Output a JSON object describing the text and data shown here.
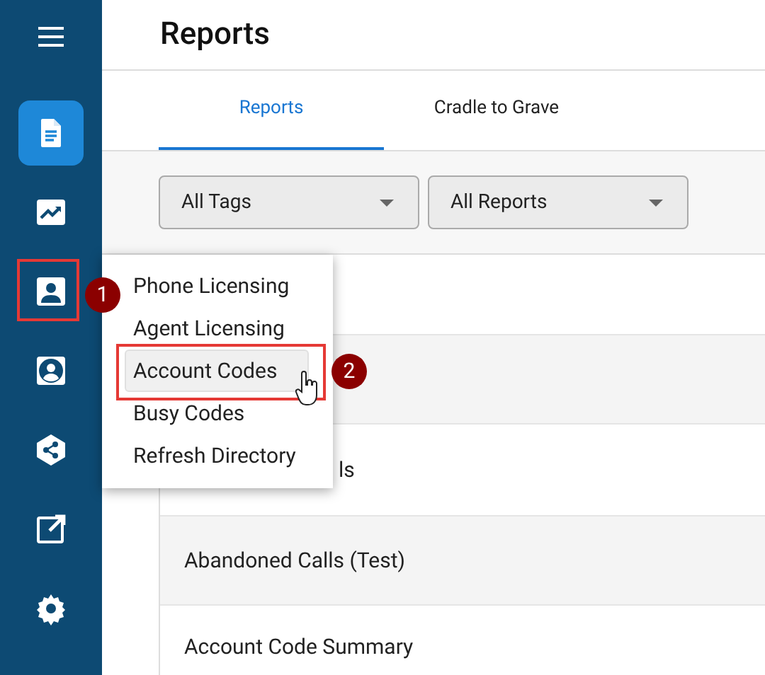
{
  "sidebar": {
    "items": [
      {
        "selected": true
      },
      {
        "selected": false
      },
      {
        "selected": false
      },
      {
        "selected": false
      },
      {
        "selected": false
      },
      {
        "selected": false
      },
      {
        "selected": false
      }
    ]
  },
  "title": "Reports",
  "tabs": [
    {
      "label": "Reports",
      "selected": true
    },
    {
      "label": "Cradle to Grave",
      "selected": false
    }
  ],
  "filters": [
    {
      "value": "All Tags"
    },
    {
      "value": "All Reports"
    }
  ],
  "rows": [
    {
      "kind": "blank"
    },
    {
      "kind": "blank"
    },
    {
      "text": "ls",
      "kind": "covered"
    },
    {
      "text": "Abandoned Calls (Test)",
      "kind": "plain"
    },
    {
      "text": "Account Code Summary",
      "kind": "plain"
    }
  ],
  "menu": {
    "items": [
      {
        "label": "Phone Licensing",
        "highlighted": false
      },
      {
        "label": "Agent Licensing",
        "highlighted": false
      },
      {
        "label": "Account Codes",
        "highlighted": true
      },
      {
        "label": "Busy Codes",
        "highlighted": false
      },
      {
        "label": "Refresh Directory",
        "highlighted": false
      }
    ]
  },
  "annotations": [
    {
      "number": "1"
    },
    {
      "number": "2"
    }
  ]
}
